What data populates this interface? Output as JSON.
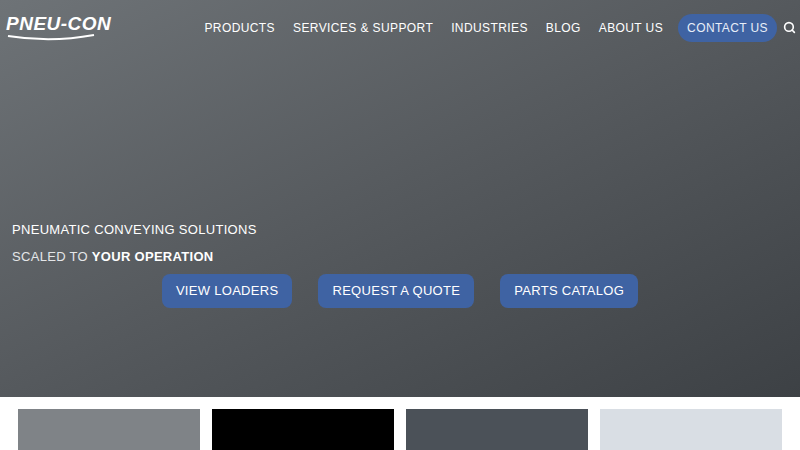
{
  "logo": {
    "text": "PNEU-CON"
  },
  "nav": {
    "items": [
      "PRODUCTS",
      "SERVICES & SUPPORT",
      "INDUSTRIES",
      "BLOG",
      "ABOUT US"
    ],
    "contact": "CONTACT US"
  },
  "hero": {
    "eyebrow": "PNEUMATIC CONVEYING SOLUTIONS",
    "tagline_prefix": "SCALED TO ",
    "tagline_bold": "YOUR OPERATION",
    "buttons": [
      "VIEW LOADERS",
      "REQUEST A QUOTE",
      "PARTS CATALOG"
    ]
  }
}
